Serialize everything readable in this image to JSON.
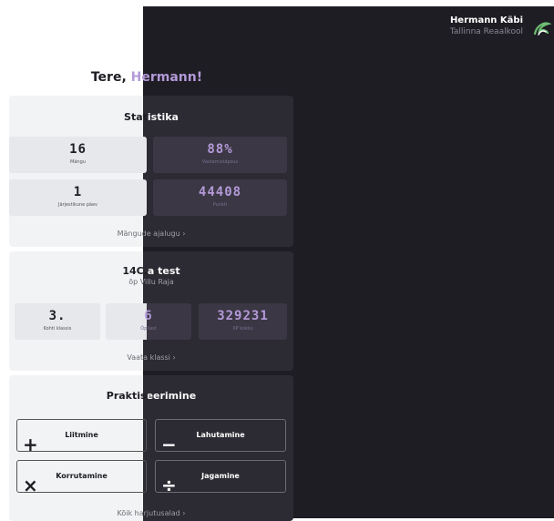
{
  "user": {
    "name": "Hermann Käbi",
    "school": "Tallinna Reaalkool"
  },
  "greeting": {
    "prefix": "Tere, ",
    "name": "Hermann!"
  },
  "stats": {
    "title": "Statistika",
    "tiles": [
      {
        "value": "16",
        "label": "Mängu"
      },
      {
        "value": "88%",
        "label": "Vastamistäpsus"
      },
      {
        "value": "1",
        "label": "Järjestikune päev"
      },
      {
        "value": "44408",
        "label": "Punkti"
      }
    ],
    "link": "Mängude ajalugu ›"
  },
  "class": {
    "title": "14C.a test",
    "teacher": "õp Villu Raja",
    "tiles": [
      {
        "value": "3.",
        "label": "Kohti klassis"
      },
      {
        "value": "6",
        "label": "Õpilast"
      },
      {
        "value": "329231",
        "label": "XP kokku"
      }
    ],
    "link": "Vaata klassi ›"
  },
  "practice": {
    "title": "Praktiseerimine",
    "ops": [
      {
        "label": "Liitmine",
        "symbol": "+"
      },
      {
        "label": "Lahutamine",
        "symbol": "−"
      },
      {
        "label": "Korrutamine",
        "symbol": "×"
      },
      {
        "label": "Jagamine",
        "symbol": "÷"
      }
    ],
    "link": "Kõik harjutusalad ›"
  }
}
